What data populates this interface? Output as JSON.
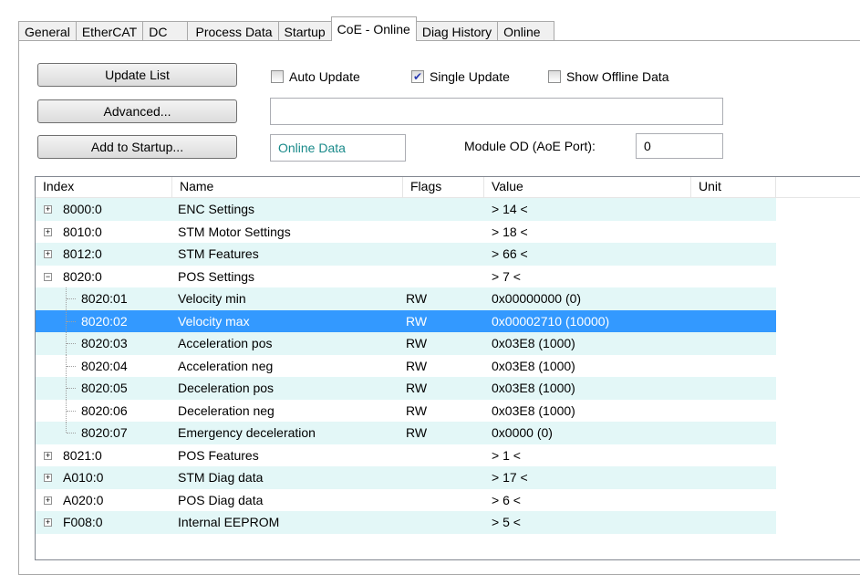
{
  "tabs": [
    "General",
    "EtherCAT",
    "DC",
    "Process Data",
    "Startup",
    "CoE - Online",
    "Diag History",
    "Online"
  ],
  "active_tab": "CoE - Online",
  "buttons": {
    "update_list": "Update List",
    "advanced": "Advanced...",
    "add_to_startup": "Add to Startup..."
  },
  "checkboxes": {
    "auto_update": {
      "label": "Auto Update",
      "checked": false
    },
    "single_update": {
      "label": "Single Update",
      "checked": true
    },
    "show_offline": {
      "label": "Show Offline Data",
      "checked": false
    }
  },
  "status_field": "",
  "online_data": "Online Data",
  "module_od_label": "Module OD (AoE Port):",
  "module_od_value": "0",
  "columns": [
    "Index",
    "Name",
    "Flags",
    "Value",
    "Unit"
  ],
  "rows": [
    {
      "index": "8000:0",
      "name": "ENC Settings",
      "flags": "",
      "value": "> 14 <",
      "expander": "+",
      "level": 0
    },
    {
      "index": "8010:0",
      "name": "STM Motor Settings",
      "flags": "",
      "value": "> 18 <",
      "expander": "+",
      "level": 0
    },
    {
      "index": "8012:0",
      "name": "STM Features",
      "flags": "",
      "value": "> 66 <",
      "expander": "+",
      "level": 0
    },
    {
      "index": "8020:0",
      "name": "POS Settings",
      "flags": "",
      "value": "> 7 <",
      "expander": "−",
      "level": 0
    },
    {
      "index": "8020:01",
      "name": "Velocity min",
      "flags": "RW",
      "value": "0x00000000 (0)",
      "level": 1
    },
    {
      "index": "8020:02",
      "name": "Velocity max",
      "flags": "RW",
      "value": "0x00002710 (10000)",
      "level": 1,
      "selected": true
    },
    {
      "index": "8020:03",
      "name": "Acceleration pos",
      "flags": "RW",
      "value": "0x03E8 (1000)",
      "level": 1
    },
    {
      "index": "8020:04",
      "name": "Acceleration neg",
      "flags": "RW",
      "value": "0x03E8 (1000)",
      "level": 1
    },
    {
      "index": "8020:05",
      "name": "Deceleration pos",
      "flags": "RW",
      "value": "0x03E8 (1000)",
      "level": 1
    },
    {
      "index": "8020:06",
      "name": "Deceleration neg",
      "flags": "RW",
      "value": "0x03E8 (1000)",
      "level": 1
    },
    {
      "index": "8020:07",
      "name": "Emergency deceleration",
      "flags": "RW",
      "value": "0x0000 (0)",
      "level": 1
    },
    {
      "index": "8021:0",
      "name": "POS Features",
      "flags": "",
      "value": "> 1 <",
      "expander": "+",
      "level": 0
    },
    {
      "index": "A010:0",
      "name": "STM Diag data",
      "flags": "",
      "value": "> 17 <",
      "expander": "+",
      "level": 0
    },
    {
      "index": "A020:0",
      "name": "POS Diag data",
      "flags": "",
      "value": "> 6 <",
      "expander": "+",
      "level": 0
    },
    {
      "index": "F008:0",
      "name": "Internal EEPROM",
      "flags": "",
      "value": "> 5 <",
      "expander": "+",
      "level": 0
    }
  ],
  "colors": {
    "selection": "#3399ff",
    "alt_row": "#e3f7f7",
    "online_data_text": "#1a8a8a"
  }
}
